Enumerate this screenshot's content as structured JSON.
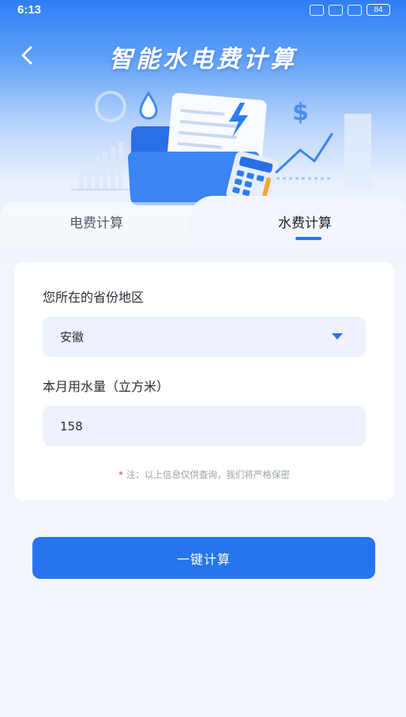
{
  "status_bar": {
    "time": "6:13",
    "battery": "84"
  },
  "header": {
    "title": "智能水电费计算",
    "back_icon": "chevron-left-icon"
  },
  "tabs": [
    {
      "label": "电费计算",
      "active": false
    },
    {
      "label": "水费计算",
      "active": true
    }
  ],
  "form": {
    "region_label": "您所在的省份地区",
    "region_value": "安徽",
    "usage_label": "本月用水量（立方米）",
    "usage_value": "158",
    "note_star": "*",
    "note_text": "注：以上信息仅供查询，我们将严格保密"
  },
  "action": {
    "calc_label": "一键计算"
  },
  "colors": {
    "accent": "#2575f0",
    "field_bg": "#eef2fc",
    "page_bg": "#f3f6fc"
  }
}
